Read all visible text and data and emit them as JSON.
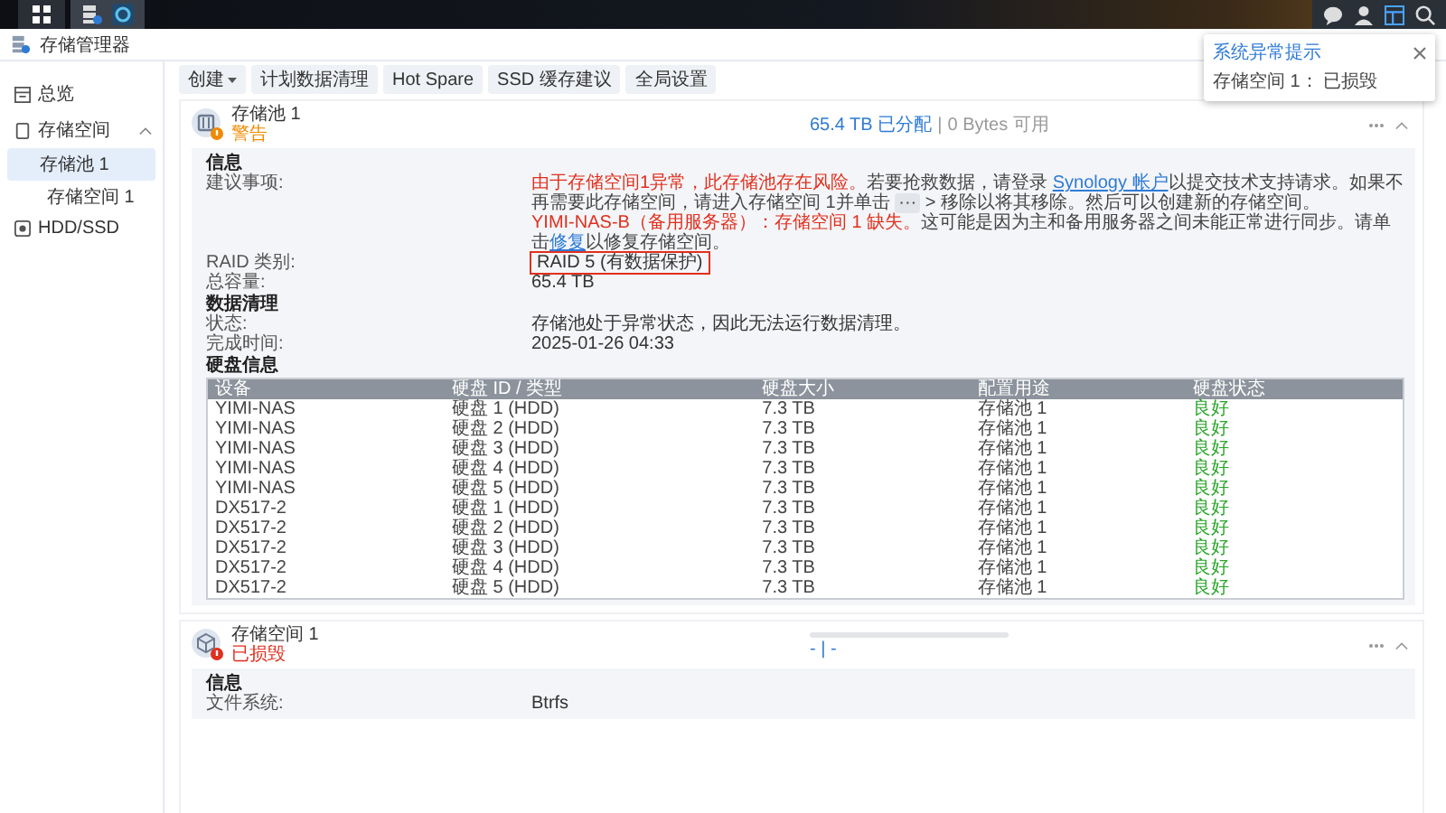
{
  "window": {
    "title": "存储管理器"
  },
  "sidebar": {
    "items": [
      {
        "label": "总览",
        "selected": false
      },
      {
        "label": "存储空间",
        "selected": false,
        "expanded": true,
        "children": [
          {
            "label": "存储池 1",
            "selected": true,
            "children": [
              {
                "label": "存储空间 1",
                "selected": false
              }
            ]
          }
        ]
      },
      {
        "label": "HDD/SSD",
        "selected": false
      }
    ]
  },
  "toolbar": {
    "buttons": [
      {
        "label": "创建",
        "dropdown": true
      },
      {
        "label": "计划数据清理",
        "dropdown": false
      },
      {
        "label": "Hot Spare",
        "dropdown": false
      },
      {
        "label": "SSD 缓存建议",
        "dropdown": false
      },
      {
        "label": "全局设置",
        "dropdown": false
      }
    ]
  },
  "pool": {
    "name": "存储池 1",
    "status": "警告",
    "allocated": "65.4 TB 已分配",
    "separator": "|",
    "available": "0 Bytes 可用",
    "sections": [
      {
        "title": "信息",
        "rows": [
          {
            "key": "建议事项:",
            "paragraphs": [
              [
                {
                  "text": "由于存储空间1异常，此存储池存在风险。",
                  "kind": "warning"
                },
                {
                  "text": "若要抢救数据，请登录 ",
                  "kind": "plain"
                },
                {
                  "text": "Synology 帐户",
                  "kind": "link"
                },
                {
                  "text": "以提交技术支持请求。如果不再需要此存储空间，请进入存储空间 1并单击 ",
                  "kind": "plain"
                },
                {
                  "text": "···",
                  "kind": "key"
                },
                {
                  "text": " > 移除以将其移除。然后可以创建新的存储空间。",
                  "kind": "plain"
                }
              ],
              [
                {
                  "text": "YIMI-NAS-B（备用服务器）：存储空间 1 缺失。",
                  "kind": "warning"
                },
                {
                  "text": "这可能是因为主和备用服务器之间未能正常进行同步。请单击",
                  "kind": "plain"
                },
                {
                  "text": "修复",
                  "kind": "link"
                },
                {
                  "text": "以修复存储空间。",
                  "kind": "plain"
                }
              ]
            ]
          },
          {
            "key": "RAID 类别:",
            "value": "RAID 5 (有数据保护)",
            "highlighted": true
          },
          {
            "key": "总容量:",
            "value": "65.4 TB",
            "highlighted": false
          }
        ]
      },
      {
        "title": "数据清理",
        "rows": [
          {
            "key": "状态:",
            "value": "存储池处于异常状态，因此无法运行数据清理。",
            "highlighted": false
          },
          {
            "key": "完成时间:",
            "value": "2025-01-26 04:33",
            "highlighted": false
          }
        ]
      }
    ],
    "disks": {
      "title": "硬盘信息",
      "columns": [
        "设备",
        "硬盘 ID / 类型",
        "硬盘大小",
        "配置用途",
        "硬盘状态"
      ],
      "rows": [
        [
          "YIMI-NAS",
          "硬盘 1 (HDD)",
          "7.3 TB",
          "存储池 1",
          "良好"
        ],
        [
          "YIMI-NAS",
          "硬盘 2 (HDD)",
          "7.3 TB",
          "存储池 1",
          "良好"
        ],
        [
          "YIMI-NAS",
          "硬盘 3 (HDD)",
          "7.3 TB",
          "存储池 1",
          "良好"
        ],
        [
          "YIMI-NAS",
          "硬盘 4 (HDD)",
          "7.3 TB",
          "存储池 1",
          "良好"
        ],
        [
          "YIMI-NAS",
          "硬盘 5 (HDD)",
          "7.3 TB",
          "存储池 1",
          "良好"
        ],
        [
          "DX517-2",
          "硬盘 1 (HDD)",
          "7.3 TB",
          "存储池 1",
          "良好"
        ],
        [
          "DX517-2",
          "硬盘 2 (HDD)",
          "7.3 TB",
          "存储池 1",
          "良好"
        ],
        [
          "DX517-2",
          "硬盘 3 (HDD)",
          "7.3 TB",
          "存储池 1",
          "良好"
        ],
        [
          "DX517-2",
          "硬盘 4 (HDD)",
          "7.3 TB",
          "存储池 1",
          "良好"
        ],
        [
          "DX517-2",
          "硬盘 5 (HDD)",
          "7.3 TB",
          "存储池 1",
          "良好"
        ]
      ]
    }
  },
  "volume": {
    "name": "存储空间 1",
    "status": "已损毁",
    "usage": "- | -",
    "section": {
      "title": "信息",
      "rows": [
        {
          "key": "文件系统:",
          "value": "Btrfs"
        }
      ]
    }
  },
  "notification": {
    "title": "系统异常提示",
    "message": "存储空间 1： 已损毁"
  }
}
